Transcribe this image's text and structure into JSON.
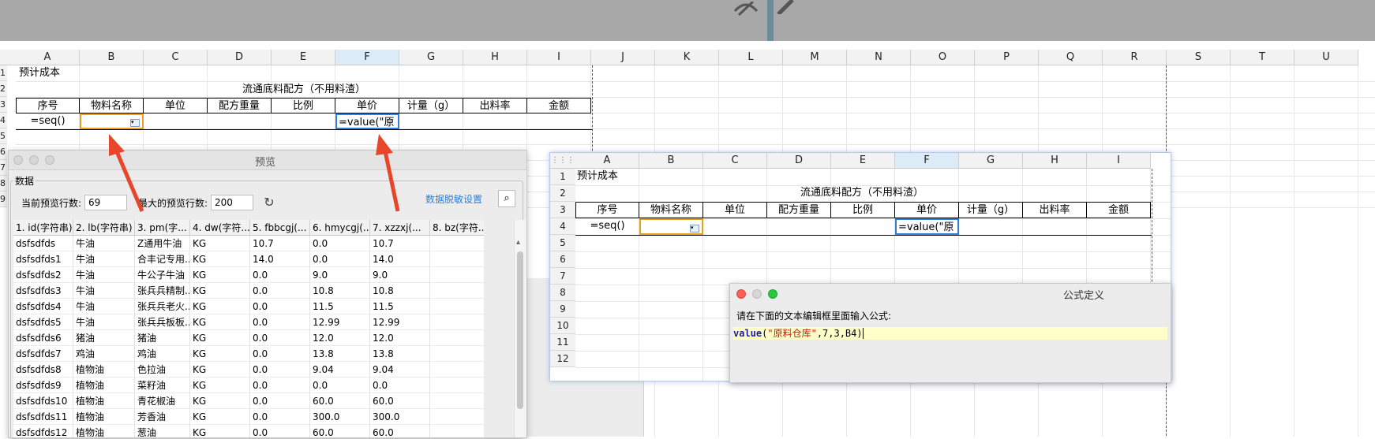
{
  "toolbar": {
    "icon_left": "eye-slash-icon",
    "icon_right": "pen-icon"
  },
  "main_sheet": {
    "columns": [
      "A",
      "B",
      "C",
      "D",
      "E",
      "F",
      "G",
      "H",
      "I",
      "J",
      "K",
      "L",
      "M",
      "N",
      "O",
      "P",
      "Q",
      "R",
      "S",
      "T",
      "U"
    ],
    "selected_column": "F",
    "row_numbers": [
      "1",
      "2",
      "3",
      "4",
      "5",
      "6",
      "7",
      "8",
      "9"
    ],
    "title_cell": "预计成本",
    "merged_title": "流通底料配方（不用料渣）",
    "headers": [
      "序号",
      "物料名称",
      "单位",
      "配方重量",
      "比例",
      "单价",
      "计量（g）",
      "出料率",
      "金额"
    ],
    "seq_formula": "=seq()",
    "price_formula": "=value(\"原"
  },
  "preview_dialog": {
    "title": "预览",
    "group_label": "数据",
    "current_rows_label": "当前预览行数:",
    "current_rows_value": "69",
    "max_rows_label": "最大的预览行数:",
    "max_rows_value": "200",
    "mask_link": "数据脱敏设置",
    "columns": [
      "1. id(字符串)",
      "2. lb(字符串)",
      "3. pm(字...",
      "4. dw(字符...",
      "5. fbbcgj(...",
      "6. hmycgj(...",
      "7. xzzxj(...",
      "8. bz(字符..."
    ],
    "rows": [
      [
        "dsfsdfds",
        "牛油",
        "Z通用牛油",
        "KG",
        "10.7",
        "0.0",
        "10.7",
        ""
      ],
      [
        "dsfsdfds1",
        "牛油",
        "合丰记专用...",
        "KG",
        "14.0",
        "0.0",
        "14.0",
        ""
      ],
      [
        "dsfsdfds2",
        "牛油",
        "牛公子牛油",
        "KG",
        "0.0",
        "9.0",
        "9.0",
        ""
      ],
      [
        "dsfsdfds3",
        "牛油",
        "张兵兵精制...",
        "KG",
        "0.0",
        "10.8",
        "10.8",
        ""
      ],
      [
        "dsfsdfds4",
        "牛油",
        "张兵兵老火...",
        "KG",
        "0.0",
        "11.5",
        "11.5",
        ""
      ],
      [
        "dsfsdfds5",
        "牛油",
        "张兵兵板板...",
        "KG",
        "0.0",
        "12.99",
        "12.99",
        ""
      ],
      [
        "dsfsdfds6",
        "猪油",
        "猪油",
        "KG",
        "0.0",
        "12.0",
        "12.0",
        ""
      ],
      [
        "dsfsdfds7",
        "鸡油",
        "鸡油",
        "KG",
        "0.0",
        "13.8",
        "13.8",
        ""
      ],
      [
        "dsfsdfds8",
        "植物油",
        "色拉油",
        "KG",
        "0.0",
        "9.04",
        "9.04",
        ""
      ],
      [
        "dsfsdfds9",
        "植物油",
        "菜籽油",
        "KG",
        "0.0",
        "0.0",
        "0.0",
        ""
      ],
      [
        "dsfsdfds10",
        "植物油",
        "青花椒油",
        "KG",
        "0.0",
        "60.0",
        "60.0",
        ""
      ],
      [
        "dsfsdfds11",
        "植物油",
        "芳香油",
        "KG",
        "0.0",
        "300.0",
        "300.0",
        ""
      ],
      [
        "dsfsdfds12",
        "植物油",
        "葱油",
        "KG",
        "0.0",
        "60.0",
        "60.0",
        ""
      ]
    ]
  },
  "sheet2": {
    "columns": [
      "A",
      "B",
      "C",
      "D",
      "E",
      "F",
      "G",
      "H",
      "I"
    ],
    "selected_column": "F",
    "row_numbers": [
      "1",
      "2",
      "3",
      "4",
      "5",
      "6",
      "7",
      "8",
      "9",
      "10",
      "11",
      "12"
    ],
    "title_cell": "预计成本",
    "merged_title": "流通底料配方（不用料渣）",
    "headers": [
      "序号",
      "物料名称",
      "单位",
      "配方重量",
      "比例",
      "单价",
      "计量（g）",
      "出料率",
      "金额"
    ],
    "seq_formula": "=seq()",
    "price_formula": "=value(\"原"
  },
  "formula_dialog": {
    "title": "公式定义",
    "prompt": "请在下面的文本编辑框里面输入公式:",
    "formula_fn": "value",
    "formula_open": "(",
    "formula_str": "\"原料仓库\"",
    "formula_rest": ",7,3,B4)"
  },
  "colors": {
    "arrow": "#e8462b",
    "selection": "#2f7fd8",
    "accent_link": "#2f7fd8"
  }
}
